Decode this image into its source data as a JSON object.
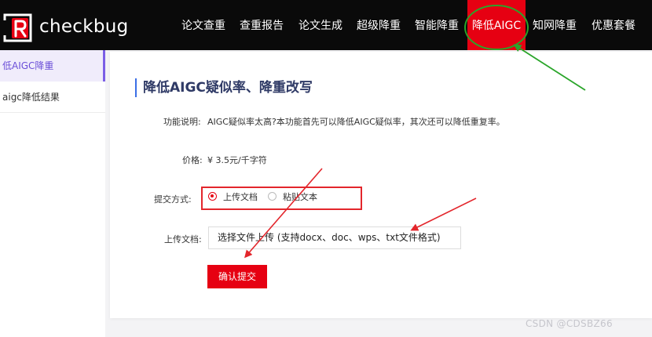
{
  "header": {
    "brand": "checkbug",
    "brand_mark_letter": "R",
    "nav": [
      {
        "label": "论文查重",
        "active": false
      },
      {
        "label": "查重报告",
        "active": false
      },
      {
        "label": "论文生成",
        "active": false
      },
      {
        "label": "超级降重",
        "active": false
      },
      {
        "label": "智能降重",
        "active": false
      },
      {
        "label": "降低AIGC",
        "active": true
      },
      {
        "label": "知网降重",
        "active": false
      },
      {
        "label": "优惠套餐",
        "active": false
      }
    ]
  },
  "sidebar": {
    "items": [
      {
        "label": "低AIGC降重",
        "active": true
      },
      {
        "label": "aigc降低结果",
        "active": false
      }
    ]
  },
  "main": {
    "title": "降低AIGC疑似率、降重改写",
    "description_label": "功能说明:",
    "description_value": "AIGC疑似率太高?本功能首先可以降低AIGC疑似率，其次还可以降低重复率。",
    "price_label": "价格:",
    "price_value": "¥ 3.5元/千字符",
    "submit_mode_label": "提交方式:",
    "submit_modes": [
      {
        "label": "上传文档",
        "checked": true
      },
      {
        "label": "粘贴文本",
        "checked": false
      }
    ],
    "upload_label": "上传文档:",
    "upload_button": "选择文件上传 (支持docx、doc、wps、txt文件格式)",
    "confirm_button": "确认提交"
  },
  "watermark": "CSDN @CDSBZ66",
  "colors": {
    "accent": "#e60012",
    "topbar": "#0a0a0a",
    "sidebar_active_text": "#6b4fd8",
    "title_text": "#2f3a66",
    "annotation_green": "#2aa52a",
    "annotation_red": "#e3262c"
  }
}
